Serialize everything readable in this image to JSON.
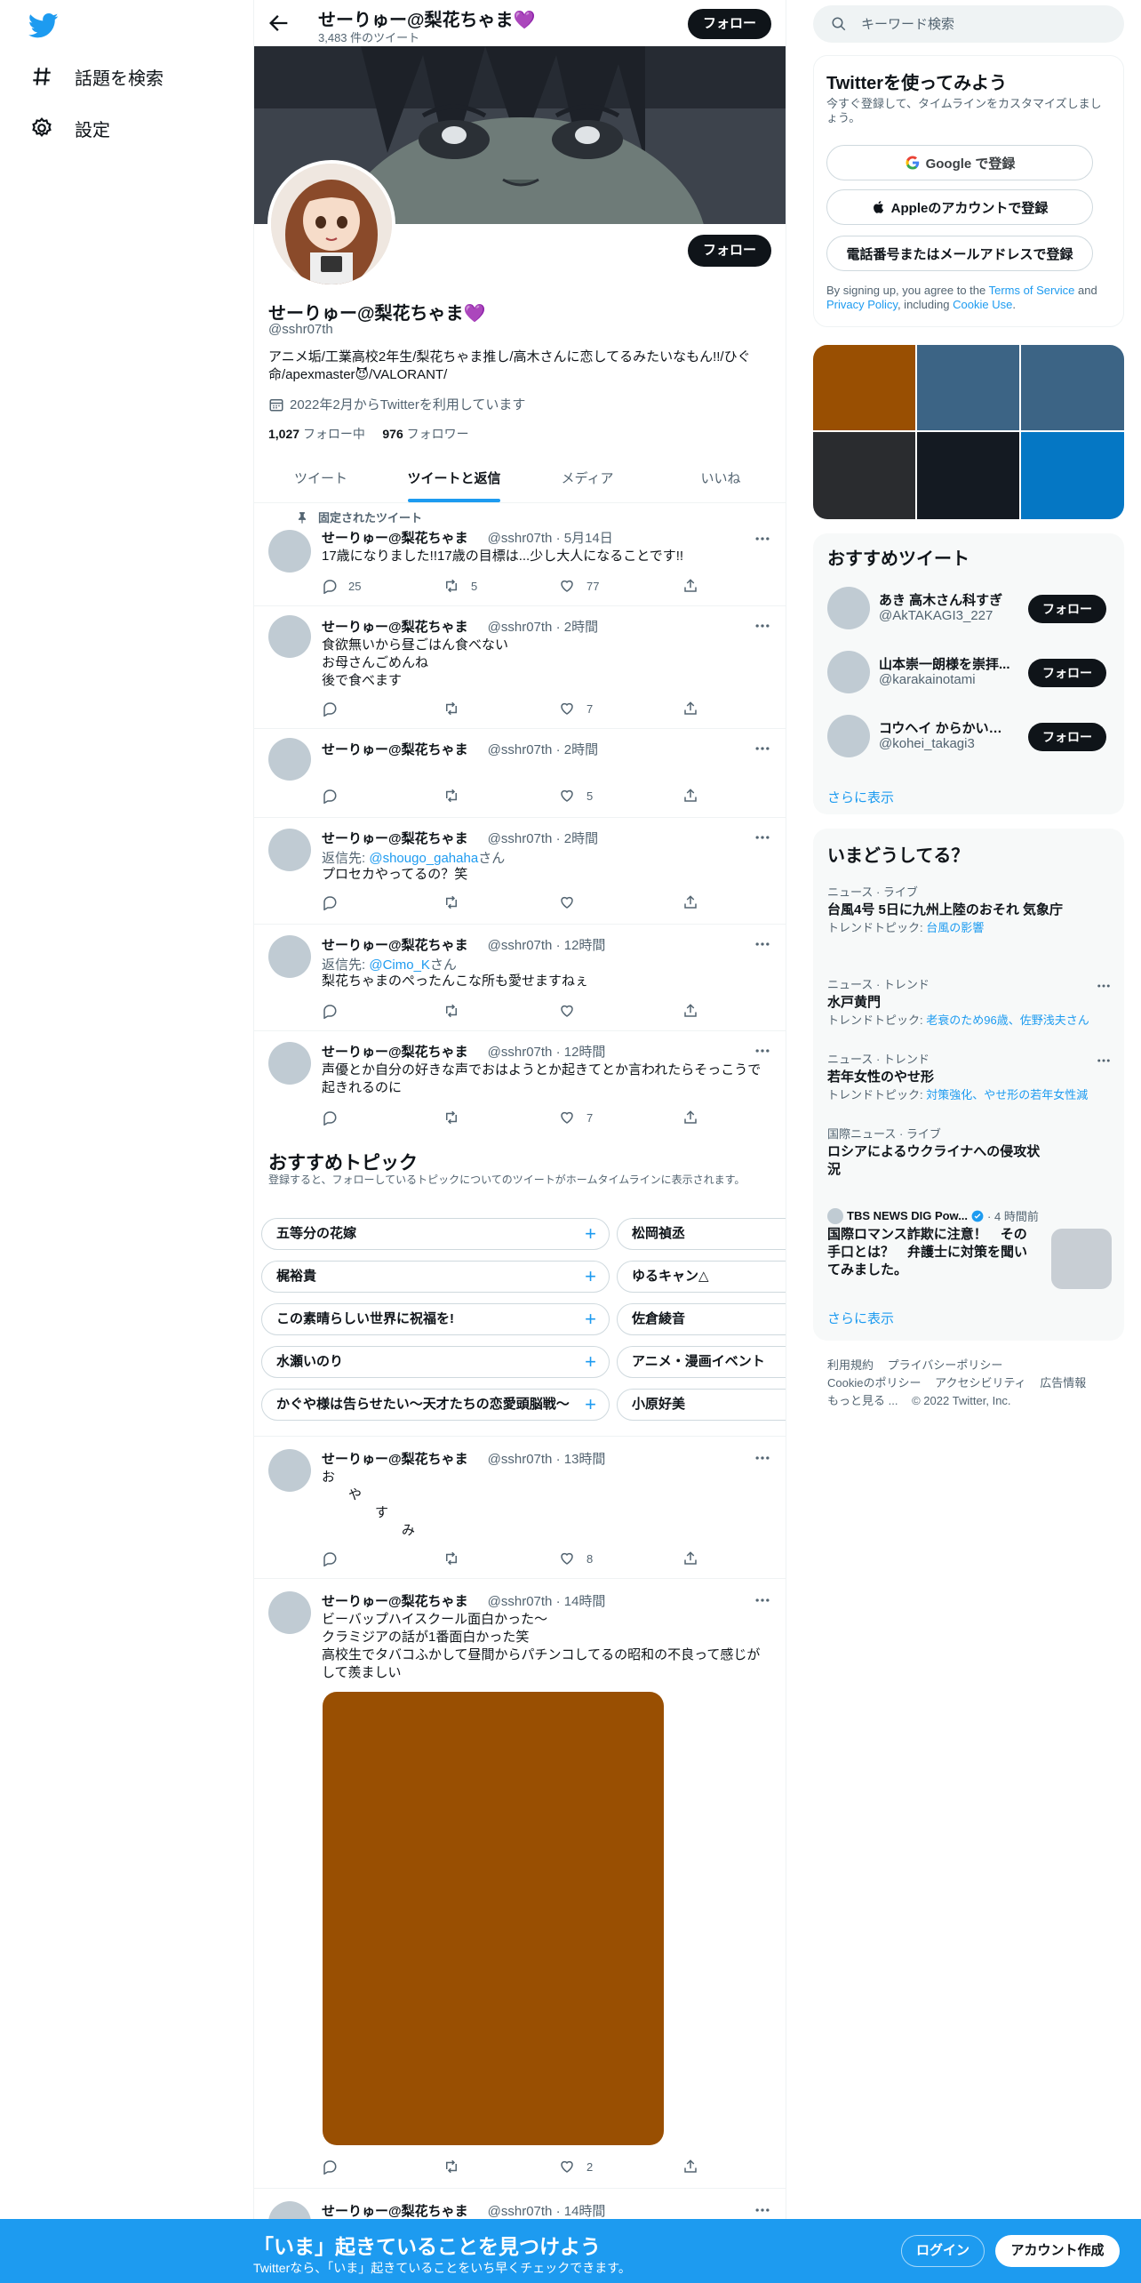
{
  "nav": {
    "explore_label": "話題を検索",
    "settings_label": "設定"
  },
  "header": {
    "name": "せーりゅー@梨花ちゃま💜",
    "tweet_count": "3,483 件のツイート",
    "follow_label": "フォロー"
  },
  "profile": {
    "name": "せーりゅー@梨花ちゃま💜",
    "handle": "@sshr07th",
    "bio": "アニメ垢/工業高校2年生/梨花ちゃま推し/高木さんに恋してるみたいなもん!!/ひぐ命/apexmaster😈/VALORANT/",
    "joined": "2022年2月からTwitterを利用しています",
    "following_count": "1,027",
    "following_label": "フォロー中",
    "followers_count": "976",
    "followers_label": "フォロワー",
    "follow_label": "フォロー"
  },
  "tabs": [
    "ツイート",
    "ツイートと返信",
    "メディア",
    "いいね"
  ],
  "tweets": [
    {
      "pinned_label": "固定されたツイート",
      "name": "せーりゅー@梨花ちゃま",
      "meta": "@sshr07th · 5月14日",
      "text": "17歳になりました!!17歳の目標は...少し大人になることです!!",
      "replies": "25",
      "retweets": "5",
      "likes": "77"
    },
    {
      "name": "せーりゅー@梨花ちゃま",
      "meta": "@sshr07th · 2時間",
      "text": "食欲無いから昼ごはん食べない\nお母さんごめんね\n後で食べます",
      "replies": "",
      "retweets": "",
      "likes": "7"
    },
    {
      "name": "せーりゅー@梨花ちゃま",
      "meta": "@sshr07th · 2時間",
      "text": "",
      "replies": "",
      "retweets": "",
      "likes": "5"
    },
    {
      "name": "せーりゅー@梨花ちゃま",
      "meta": "@sshr07th · 2時間",
      "reply_prefix": "返信先: ",
      "reply_to": "@shougo_gahaha",
      "reply_suffix": "さん",
      "text": "プロセカやってるの？笑",
      "replies": "",
      "retweets": "",
      "likes": ""
    },
    {
      "name": "せーりゅー@梨花ちゃま",
      "meta": "@sshr07th · 12時間",
      "reply_prefix": "返信先: ",
      "reply_to": "@Cimo_K",
      "reply_suffix": "さん",
      "text": "梨花ちゃまのぺったんこな所も愛せますねぇ",
      "replies": "",
      "retweets": "",
      "likes": ""
    },
    {
      "name": "せーりゅー@梨花ちゃま",
      "meta": "@sshr07th · 12時間",
      "text": "声優とか自分の好きな声でおはようとか起きてとか言われたらそっこうで起きれるのに",
      "replies": "",
      "retweets": "",
      "likes": "7"
    },
    {
      "name": "せーりゅー@梨花ちゃま",
      "meta": "@sshr07th · 13時間",
      "text": "お\n　　や\n　　　　す\n　　　　　　み",
      "replies": "",
      "retweets": "",
      "likes": "8"
    },
    {
      "name": "せーりゅー@梨花ちゃま",
      "meta": "@sshr07th · 14時間",
      "text": "ビーバップハイスクール面白かった〜\nクラミジアの話が1番面白かった笑\n高校生でタバコふかして昼間からパチンコしてるの昭和の不良って感じがして羨ましい",
      "replies": "",
      "retweets": "",
      "likes": "2"
    },
    {
      "name": "せーりゅー@梨花ちゃま",
      "meta": "@sshr07th · 14時間"
    }
  ],
  "topics": {
    "title": "おすすめトピック",
    "subtitle": "登録すると、フォローしているトピックについてのツイートがホームタイムラインに表示されます。",
    "chips": [
      [
        "五等分の花嫁",
        "松岡禎丞"
      ],
      [
        "梶裕貴",
        "ゆるキャン△"
      ],
      [
        "この素晴らしい世界に祝福を!",
        "佐倉綾音"
      ],
      [
        "水瀬いのり",
        "アニメ・漫画イベント"
      ],
      [
        "かぐや様は告らせたい〜天才たちの恋愛頭脳戦〜",
        "小原好美"
      ]
    ]
  },
  "search": {
    "placeholder": "キーワード検索"
  },
  "signup": {
    "title": "Twitterを使ってみよう",
    "subtitle": "今すぐ登録して、タイムラインをカスタマイズしましょう。",
    "google": "Google で登録",
    "apple": "Appleのアカウントで登録",
    "phone": "電話番号またはメールアドレスで登録",
    "legal_prefix": "By signing up, you agree to the ",
    "terms": "Terms of Service",
    "legal_and": " and ",
    "privacy": "Privacy Policy",
    "legal_including": ", including ",
    "cookie": "Cookie Use",
    "legal_end": "."
  },
  "media_grid_colors": [
    "#994f02",
    "#3c6485",
    "#3c6485",
    "#2a2c2f",
    "#141a22",
    "#0577c4"
  ],
  "recs": {
    "title": "おすすめツイート",
    "items": [
      {
        "name": "あき 高木さん科すぎ",
        "handle": "@AkTAKAGI3_227"
      },
      {
        "name": "山本崇一朗様を崇拝...",
        "handle": "@karakainotami"
      },
      {
        "name": "コウヘイ からかい上...",
        "handle": "@kohei_takagi3"
      }
    ],
    "follow_label": "フォロー",
    "more": "さらに表示"
  },
  "trends": {
    "title": "いまどうしてる？",
    "items": [
      {
        "meta": "ニュース · ライブ",
        "title": "台風4号 5日に九州上陸のおそれ 気象庁",
        "sub_prefix": "トレンドトピック: ",
        "sub": "台風の影響"
      },
      {
        "meta": "ニュース · トレンド",
        "title": "水戸黄門",
        "sub_prefix": "トレンドトピック: ",
        "sub": "老衰のため96歳、佐野浅夫さん"
      },
      {
        "meta": "ニュース · トレンド",
        "title": "若年女性のやせ形",
        "sub_prefix": "トレンドトピック: ",
        "sub": "対策強化、やせ形の若年女性減"
      },
      {
        "meta": "国際ニュース · ライブ",
        "title": "ロシアによるウクライナへの侵攻状況"
      }
    ],
    "news": {
      "source": "TBS NEWS DIG Pow...",
      "time": "· 4 時間前",
      "title": "国際ロマンス詐欺に注意！　その手口とは？　弁護士に対策を聞いてみました。"
    },
    "more": "さらに表示"
  },
  "footer": {
    "links": [
      "利用規約",
      "プライバシーポリシー",
      "Cookieのポリシー",
      "アクセシビリティ",
      "広告情報",
      "もっと見る ...",
      "© 2022 Twitter, Inc."
    ]
  },
  "bottombar": {
    "title": "「いま」起きていることを見つけよう",
    "subtitle": "Twitterなら、「いま」起きていることをいち早くチェックできます。",
    "login": "ログイン",
    "signup": "アカウント作成"
  },
  "colors": {
    "accent": "#1d9bf0",
    "text": "#0f1419",
    "muted": "#536471"
  }
}
